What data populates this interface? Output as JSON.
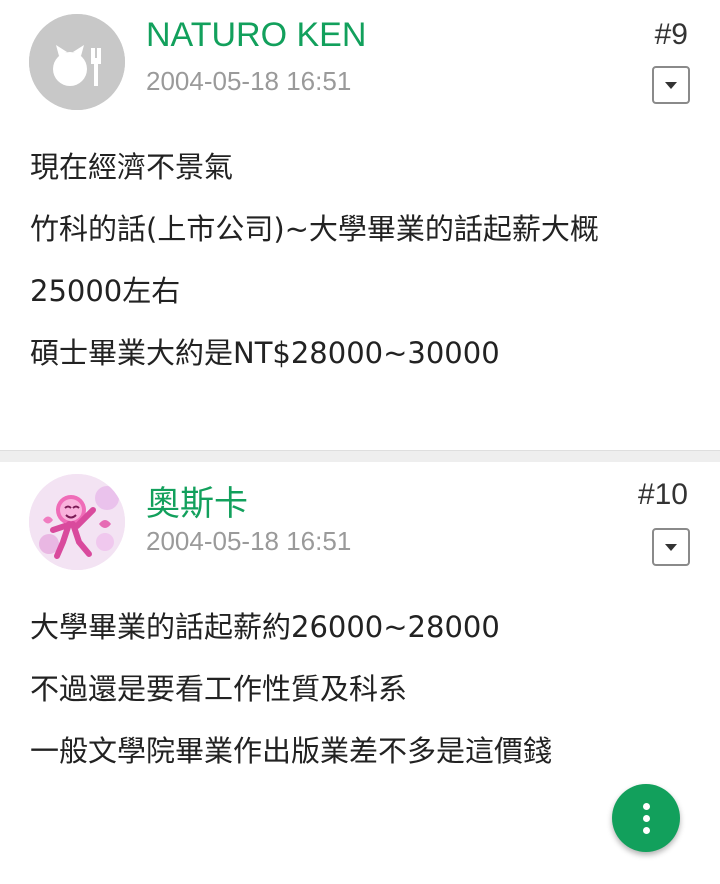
{
  "posts": [
    {
      "author": "NATURO KEN",
      "timestamp": "2004-05-18 16:51",
      "floor": "#9",
      "avatar_icon": "default-avatar-icon",
      "lines": [
        "現在經濟不景氣",
        "竹科的話(上市公司)~大學畢業的話起薪大概",
        "25000左右",
        "碩士畢業大約是NT$28000~30000"
      ]
    },
    {
      "author": "奧斯卡",
      "timestamp": "2004-05-18 16:51",
      "floor": "#10",
      "avatar_icon": "cartoon-avatar-icon",
      "lines": [
        "大學畢業的話起薪約26000~28000",
        "不過還是要看工作性質及科系",
        "一般文學院畢業作出版業差不多是這價錢"
      ]
    }
  ],
  "fab_icon": "more-vertical-icon",
  "colors": {
    "accent": "#12a05c",
    "timestamp": "#9a9a9a",
    "divider": "#eeeeee"
  }
}
